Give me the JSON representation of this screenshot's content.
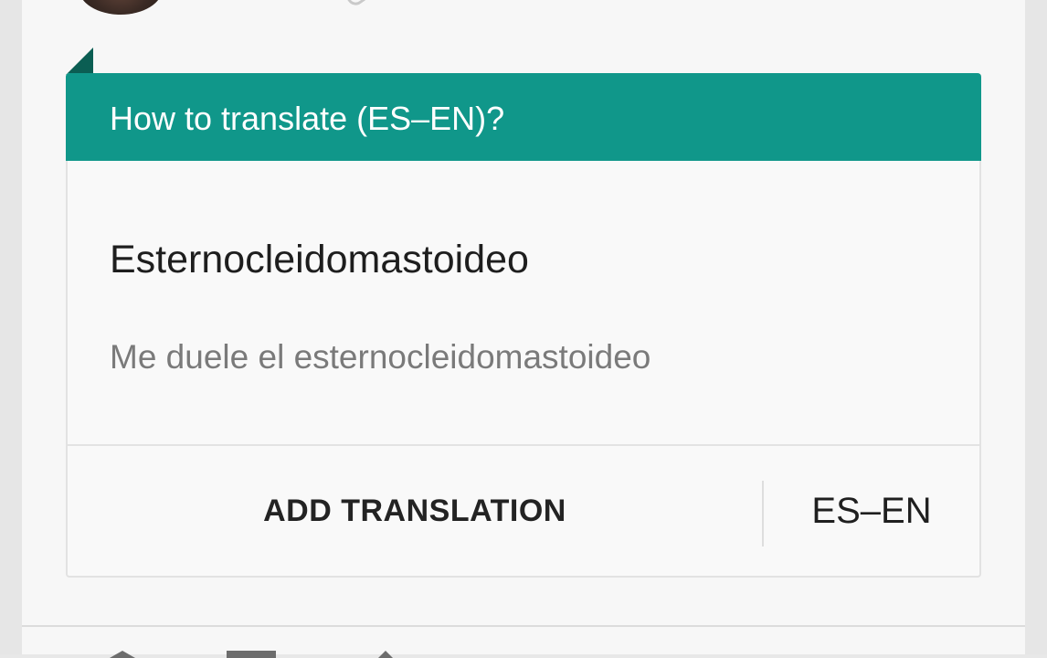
{
  "card": {
    "title": "How to translate (ES–EN)?",
    "word": "Esternocleidomastoideo",
    "example": "Me duele el esternocleidomastoideo",
    "add_translation_label": "ADD TRANSLATION",
    "language_pair": "ES–EN"
  },
  "icons": [
    "avatar",
    "share-icon",
    "comment-icon",
    "more-icon"
  ],
  "colors": {
    "header": "#10978a",
    "header_fold": "#0b5e53",
    "card_background": "#f9f9f9",
    "example_text": "#7a7a7a"
  }
}
